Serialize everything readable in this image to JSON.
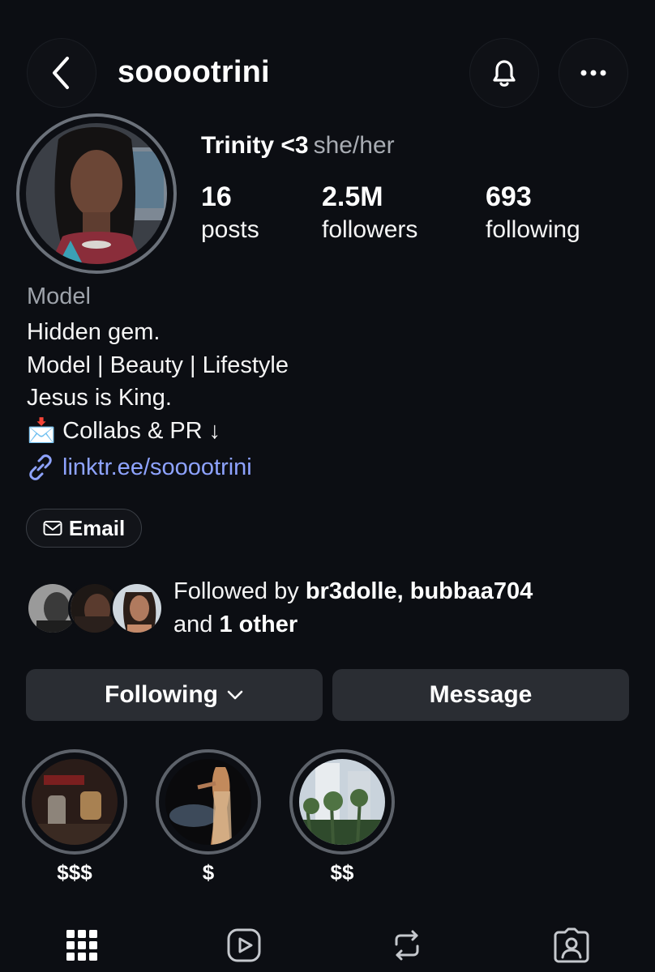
{
  "header": {
    "username": "sooootrini",
    "back_icon": "chevron-left-icon",
    "bell_icon": "bell-icon",
    "more_icon": "more-horizontal-icon"
  },
  "profile": {
    "display_name": "Trinity <3",
    "pronouns": "she/her",
    "stats": [
      {
        "value": "16",
        "label": "posts"
      },
      {
        "value": "2.5M",
        "label": "followers"
      },
      {
        "value": "693",
        "label": "following"
      }
    ],
    "category": "Model",
    "bio": {
      "line1": "Hidden gem.",
      "line2": "Model | Beauty | Lifestyle",
      "line3": "Jesus is King.",
      "line4_emoji": "📩",
      "line4": "Collabs & PR ↓"
    },
    "link": "linktr.ee/sooootrini",
    "email_button": "Email"
  },
  "mutuals": {
    "prefix": "Followed by ",
    "names": "br3dolle, bubbaa704",
    "and": "and ",
    "others": "1 other"
  },
  "actions": {
    "following": "Following",
    "message": "Message"
  },
  "highlights": [
    {
      "label": "$$$"
    },
    {
      "label": "$"
    },
    {
      "label": "$$"
    }
  ],
  "tabs": [
    "grid-icon",
    "reels-icon",
    "reposts-icon",
    "tagged-icon"
  ],
  "colors": {
    "background": "#0c0e13",
    "link": "#8ea3ff",
    "button": "#2a2d33",
    "muted_text": "#9ea3ab"
  }
}
